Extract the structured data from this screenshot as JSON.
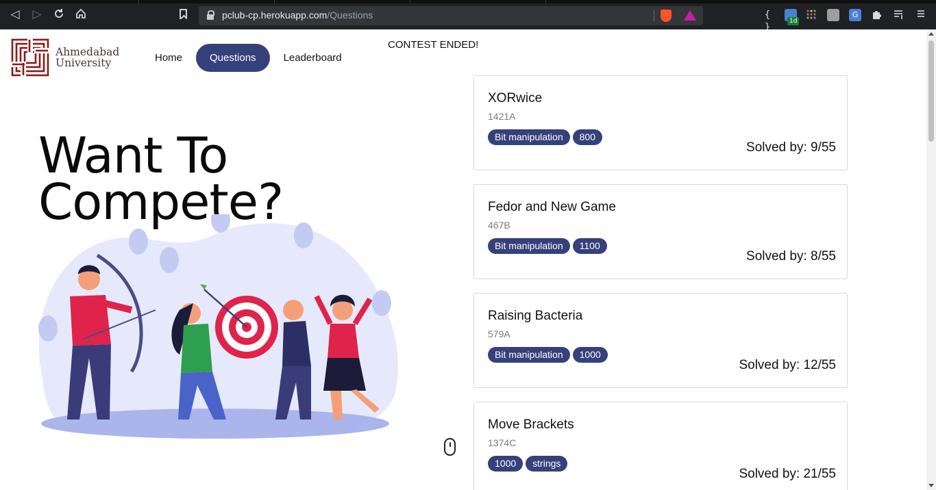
{
  "browser": {
    "url_host": "pclub-cp.herokuapp.com",
    "url_path": "/Questions",
    "extension_badge": "1d"
  },
  "site": {
    "logo_line1": "Ahmedabad",
    "logo_line2": "University",
    "nav": [
      {
        "label": "Home",
        "active": false
      },
      {
        "label": "Questions",
        "active": true
      },
      {
        "label": "Leaderboard",
        "active": false
      }
    ],
    "status": "CONTEST ENDED!",
    "hero_line1": "Want To",
    "hero_line2": "Compete?",
    "accent_color": "#36407a",
    "logo_color": "#8b1a1a"
  },
  "questions": [
    {
      "title": "XORwice",
      "code": "1421A",
      "tags": [
        "Bit manipulation",
        "800"
      ],
      "solved": "Solved by: 9/55"
    },
    {
      "title": "Fedor and New Game",
      "code": "467B",
      "tags": [
        "Bit manipulation",
        "1100"
      ],
      "solved": "Solved by: 8/55"
    },
    {
      "title": "Raising Bacteria",
      "code": "579A",
      "tags": [
        "Bit manipulation",
        "1000"
      ],
      "solved": "Solved by: 12/55"
    },
    {
      "title": "Move Brackets",
      "code": "1374C",
      "tags": [
        "1000",
        "strings"
      ],
      "solved": "Solved by: 21/55"
    }
  ]
}
